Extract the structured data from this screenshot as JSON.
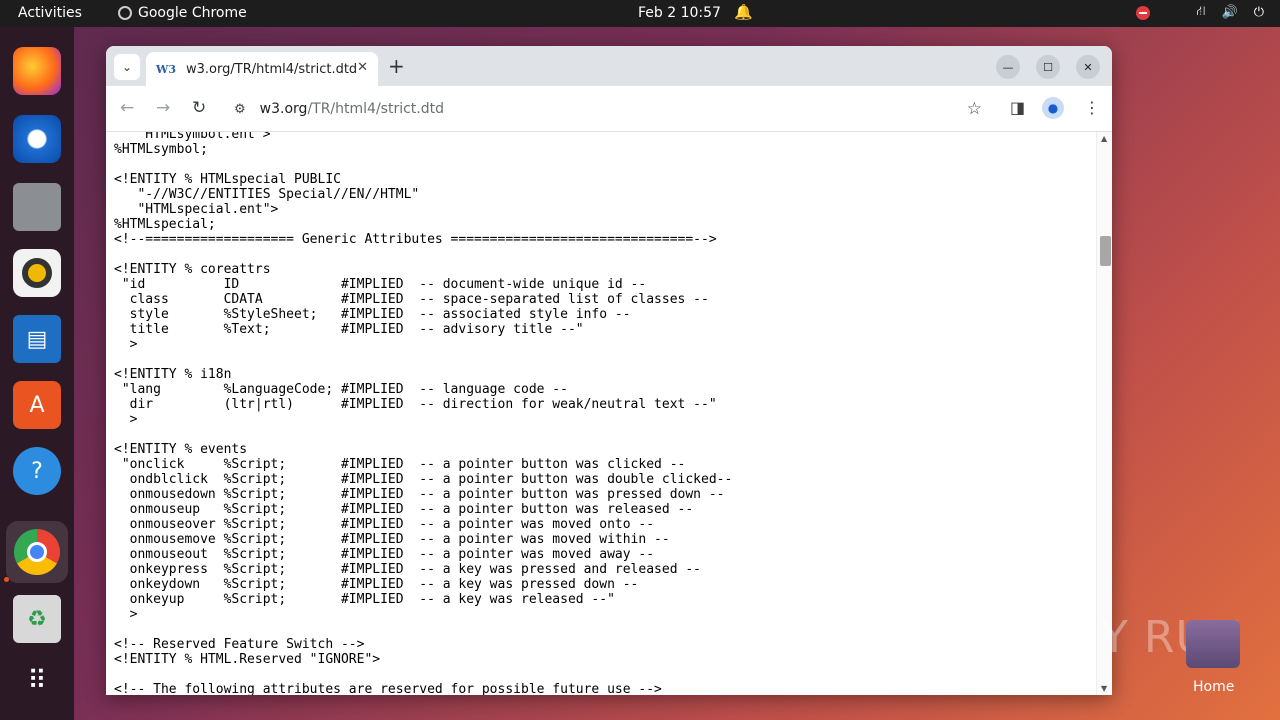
{
  "topbar": {
    "activities": "Activities",
    "app_name": "Google Chrome",
    "clock": "Feb 2  10:57"
  },
  "dock": {
    "items": [
      "firefox-icon",
      "thunderbird-icon",
      "files-icon",
      "rhythmbox-icon",
      "writer-icon",
      "software-icon",
      "help-icon",
      "chrome-icon",
      "trash-icon",
      "apps-grid-icon"
    ],
    "accent_color": "#e95420"
  },
  "browser": {
    "tab": {
      "favicon": "W3",
      "title": "w3.org/TR/html4/strict.dtd"
    },
    "url": {
      "host": "w3.org",
      "path": "/TR/html4/strict.dtd"
    },
    "content_lines": [
      "   \"HTMLsymbol.ent\">",
      "%HTMLsymbol;",
      "",
      "<!ENTITY % HTMLspecial PUBLIC",
      "   \"-//W3C//ENTITIES Special//EN//HTML\"",
      "   \"HTMLspecial.ent\">",
      "%HTMLspecial;",
      "<!--=================== Generic Attributes ===============================-->",
      "",
      "<!ENTITY % coreattrs",
      " \"id          ID             #IMPLIED  -- document-wide unique id --",
      "  class       CDATA          #IMPLIED  -- space-separated list of classes --",
      "  style       %StyleSheet;   #IMPLIED  -- associated style info --",
      "  title       %Text;         #IMPLIED  -- advisory title --\"",
      "  >",
      "",
      "<!ENTITY % i18n",
      " \"lang        %LanguageCode; #IMPLIED  -- language code --",
      "  dir         (ltr|rtl)      #IMPLIED  -- direction for weak/neutral text --\"",
      "  >",
      "",
      "<!ENTITY % events",
      " \"onclick     %Script;       #IMPLIED  -- a pointer button was clicked --",
      "  ondblclick  %Script;       #IMPLIED  -- a pointer button was double clicked--",
      "  onmousedown %Script;       #IMPLIED  -- a pointer button was pressed down --",
      "  onmouseup   %Script;       #IMPLIED  -- a pointer button was released --",
      "  onmouseover %Script;       #IMPLIED  -- a pointer was moved onto --",
      "  onmousemove %Script;       #IMPLIED  -- a pointer was moved within --",
      "  onmouseout  %Script;       #IMPLIED  -- a pointer was moved away --",
      "  onkeypress  %Script;       #IMPLIED  -- a key was pressed and released --",
      "  onkeydown   %Script;       #IMPLIED  -- a key was pressed down --",
      "  onkeyup     %Script;       #IMPLIED  -- a key was released --\"",
      "  >",
      "",
      "<!-- Reserved Feature Switch -->",
      "<!ENTITY % HTML.Reserved \"IGNORE\">",
      "",
      "<!-- The following attributes are reserved for possible future use -->"
    ]
  },
  "desktop": {
    "watermark": "ANY RUN",
    "home_label": "Home"
  }
}
